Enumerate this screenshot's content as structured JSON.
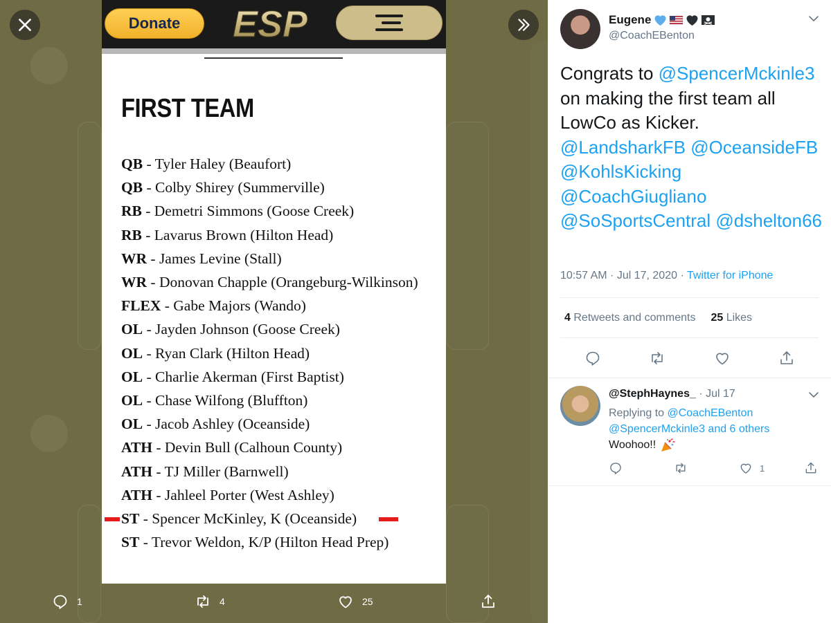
{
  "viewer": {
    "photo": {
      "donate_label": "Donate",
      "logo_text": "ESP",
      "section_title": "FIRST TEAM",
      "roster": [
        {
          "pos": "QB",
          "text": " - Tyler Haley (Beaufort)"
        },
        {
          "pos": "QB",
          "text": " - Colby Shirey (Summerville)"
        },
        {
          "pos": "RB",
          "text": " - Demetri Simmons (Goose Creek)"
        },
        {
          "pos": "RB",
          "text": " - Lavarus Brown (Hilton Head)"
        },
        {
          "pos": "WR",
          "text": " - James Levine (Stall)"
        },
        {
          "pos": "WR",
          "text": " - Donovan Chapple (Orangeburg-Wilkinson)"
        },
        {
          "pos": "FLEX",
          "text": " - Gabe Majors (Wando)"
        },
        {
          "pos": "OL",
          "text": " - Jayden Johnson (Goose Creek)"
        },
        {
          "pos": "OL",
          "text": " - Ryan Clark (Hilton Head)"
        },
        {
          "pos": "OL",
          "text": " - Charlie Akerman (First Baptist)"
        },
        {
          "pos": "OL",
          "text": " - Chase Wilfong (Bluffton)"
        },
        {
          "pos": "OL",
          "text": " - Jacob Ashley (Oceanside)"
        },
        {
          "pos": "ATH",
          "text": " - Devin Bull (Calhoun County)"
        },
        {
          "pos": "ATH",
          "text": " - TJ Miller (Barnwell)"
        },
        {
          "pos": "ATH",
          "text": " - Jahleel Porter (West Ashley)"
        },
        {
          "pos": "ST",
          "text": " - Spencer McKinley, K (Oceanside)"
        },
        {
          "pos": "ST",
          "text": " - Trevor Weldon, K/P (Hilton Head Prep)"
        }
      ],
      "highlight_color": "#e51c1c"
    },
    "actions": {
      "reply_count": "1",
      "retweet_count": "4",
      "like_count": "25"
    }
  },
  "tweet": {
    "author": {
      "name": "Eugene",
      "handle": "@CoachEBenton",
      "emoji": [
        "blue-heart",
        "us-flag",
        "black-heart",
        "pirate-flag"
      ]
    },
    "text_prefix": "Congrats to ",
    "mention_1": "@SpencerMckinle3",
    "text_middle": " on making the first team all LowCo as Kicker. ",
    "mentions": [
      "@LandsharkFB",
      "@OceansideFB",
      "@KohlsKicking",
      "@CoachGiugliano",
      "@SoSportsCentral",
      "@dshelton66"
    ],
    "timestamp": "10:57 AM · Jul 17, 2020 · ",
    "source": "Twitter for iPhone",
    "retweets_count": "4",
    "retweets_label": "Retweets and comments",
    "likes_count": "25",
    "likes_label": "Likes",
    "link_color": "#1da1f2"
  },
  "reply": {
    "handle": "@StephHaynes_",
    "date": " · Jul 17",
    "replying_label": "Replying to ",
    "replying_to": "@CoachEBenton",
    "replying_more": "@SpencerMckinle3 and 6 others",
    "text": "Woohoo!!",
    "like_count": "1"
  }
}
